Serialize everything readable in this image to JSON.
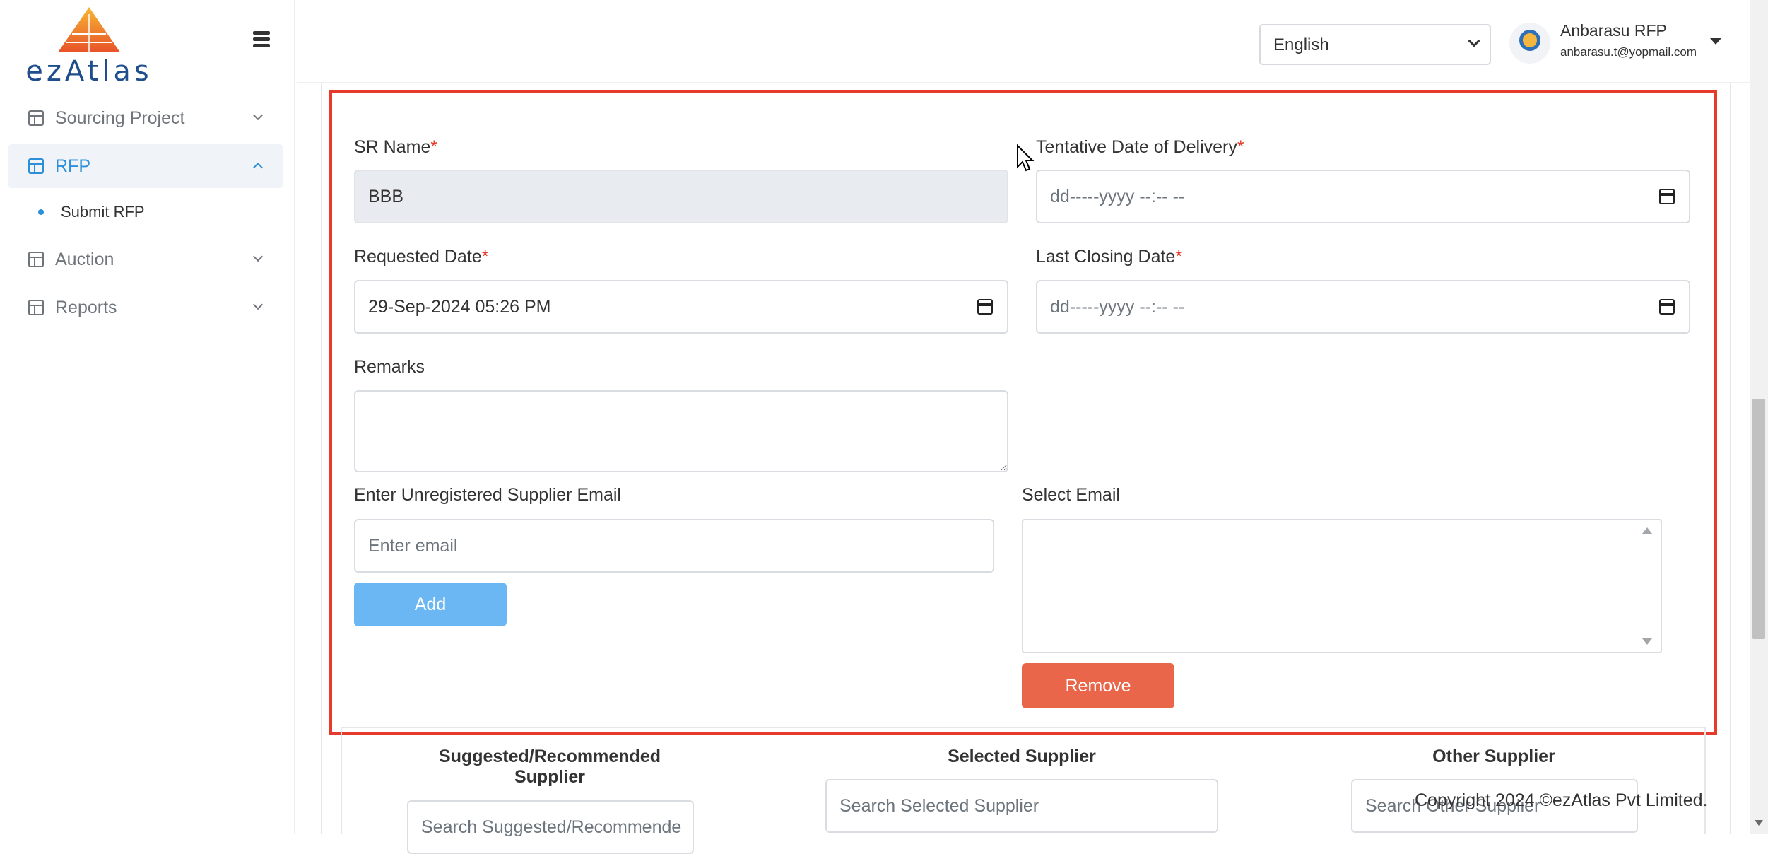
{
  "app": {
    "logo_text": "ezAtlas"
  },
  "sidebar": {
    "items": [
      {
        "label": "Sourcing Project",
        "expanded": false
      },
      {
        "label": "RFP",
        "expanded": true,
        "active": true,
        "children": [
          {
            "label": "Submit RFP"
          }
        ]
      },
      {
        "label": "Auction",
        "expanded": false
      },
      {
        "label": "Reports",
        "expanded": false
      }
    ]
  },
  "header": {
    "language": "English",
    "user": {
      "name": "Anbarasu RFP",
      "email": "anbarasu.t@yopmail.com"
    }
  },
  "form": {
    "sr_name": {
      "label": "SR Name",
      "required_mark": "*",
      "value": "BBB"
    },
    "tentative_date": {
      "label": "Tentative Date of Delivery",
      "required_mark": "*",
      "placeholder": "dd-----yyyy --:-- --"
    },
    "requested_date": {
      "label": "Requested Date",
      "required_mark": "*",
      "value": "29-Sep-2024 05:26 PM"
    },
    "last_closing_date": {
      "label": "Last Closing Date",
      "required_mark": "*",
      "placeholder": "dd-----yyyy --:-- --"
    },
    "remarks": {
      "label": "Remarks",
      "value": ""
    },
    "unregistered_email": {
      "label": "Enter Unregistered Supplier Email",
      "placeholder": "Enter email"
    },
    "add_button": "Add",
    "select_email": {
      "label": "Select Email"
    },
    "remove_button": "Remove"
  },
  "suppliers": {
    "suggested": {
      "title_line1": "Suggested/Recommended",
      "title_line2": "Supplier",
      "search_placeholder": "Search Suggested/Recommende"
    },
    "selected": {
      "title": "Selected Supplier",
      "search_placeholder": "Search Selected Supplier"
    },
    "other": {
      "title": "Other Supplier",
      "search_placeholder": "Search Other Supplier"
    }
  },
  "footer": {
    "copyright": "Copyright 2024 ©ezAtlas Pvt Limited."
  },
  "colors": {
    "accent": "#2d8fd8",
    "highlight_frame": "#e53a2c",
    "add_button": "#6ab7f4",
    "remove_button": "#e9664a"
  }
}
